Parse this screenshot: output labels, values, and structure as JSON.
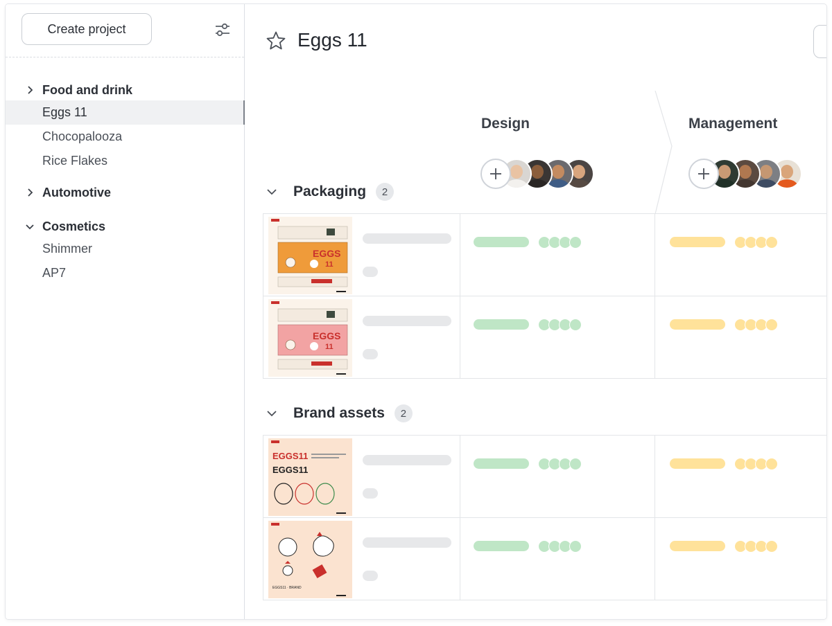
{
  "sidebar": {
    "create_button": "Create project",
    "groups": [
      {
        "label": "Food and drink",
        "expanded": false
      },
      {
        "label": "Automotive",
        "expanded": false
      },
      {
        "label": "Cosmetics",
        "expanded": true
      }
    ],
    "food_items": [
      "Eggs 11",
      "Chocopalooza",
      "Rice Flakes"
    ],
    "cosmetics_items": [
      "Shimmer",
      "AP7"
    ],
    "active_item": "Eggs 11"
  },
  "main": {
    "title": "Eggs 11",
    "columns": [
      {
        "label": "Design",
        "status_color": "#bfe6c6"
      },
      {
        "label": "Management",
        "status_color": "#ffe29a"
      }
    ],
    "sections": [
      {
        "title": "Packaging",
        "count": "2"
      },
      {
        "title": "Brand assets",
        "count": "2"
      }
    ]
  },
  "colors": {
    "design_status": "#bfe6c6",
    "management_status": "#ffe29a",
    "skeleton": "#e7e8ea",
    "active_bg": "#f0f1f3"
  },
  "icons": [
    "filter-sliders-icon",
    "chevron-right-icon",
    "chevron-down-icon",
    "star-icon",
    "plus-icon"
  ]
}
